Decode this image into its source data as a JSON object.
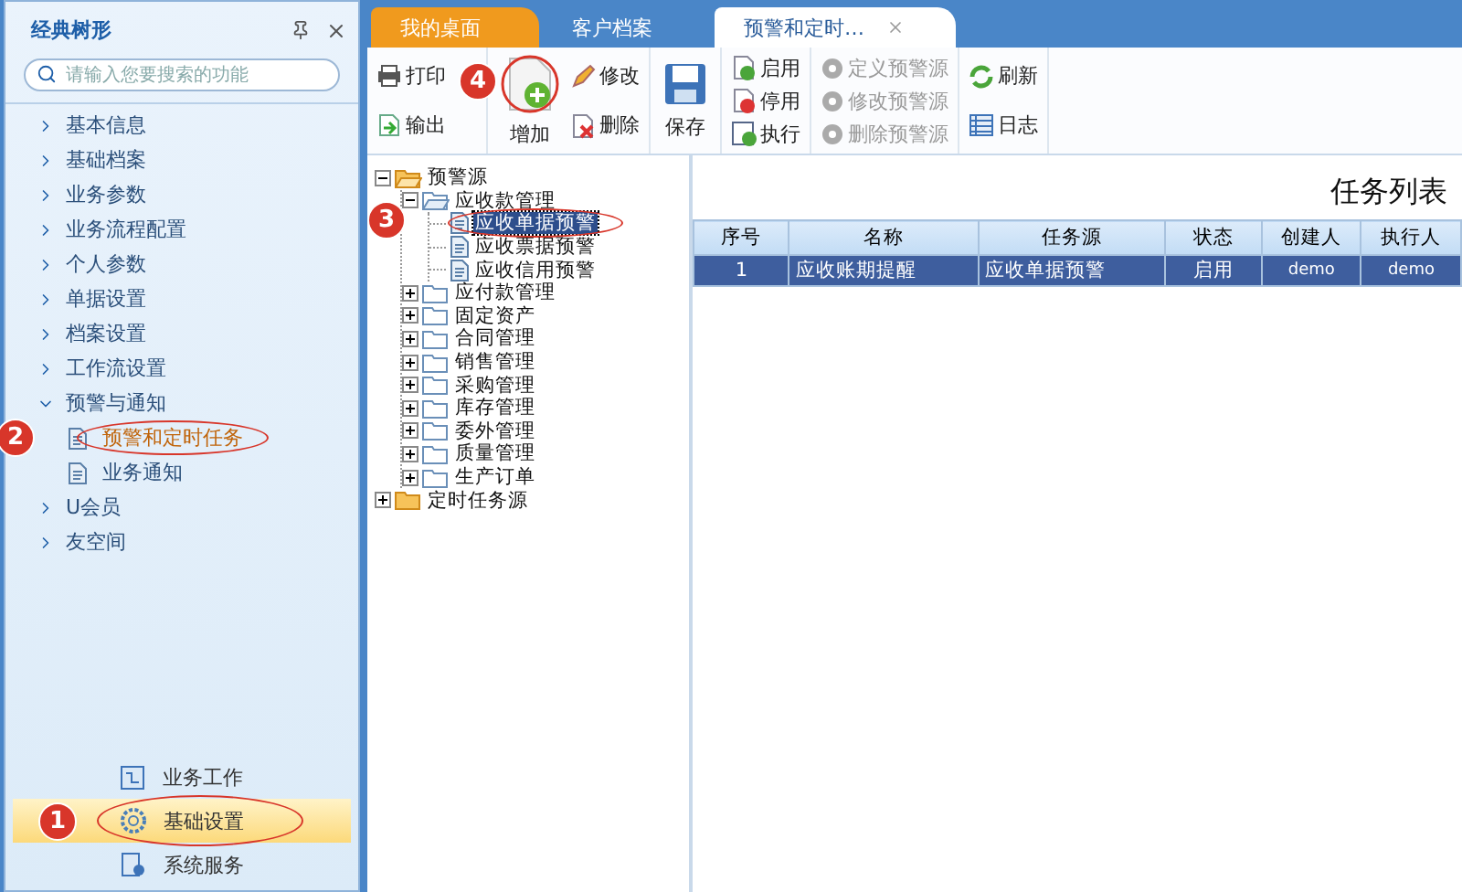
{
  "sidebar": {
    "title": "经典树形",
    "search": {
      "placeholder": "请输入您要搜索的功能"
    },
    "items": [
      {
        "label": "基本信息",
        "expanded": false
      },
      {
        "label": "基础档案",
        "expanded": false
      },
      {
        "label": "业务参数",
        "expanded": false
      },
      {
        "label": "业务流程配置",
        "expanded": false
      },
      {
        "label": "个人参数",
        "expanded": false
      },
      {
        "label": "单据设置",
        "expanded": false
      },
      {
        "label": "档案设置",
        "expanded": false
      },
      {
        "label": "工作流设置",
        "expanded": false
      },
      {
        "label": "预警与通知",
        "expanded": true,
        "children": [
          {
            "label": "预警和定时任务",
            "selected": true,
            "callout": "2"
          },
          {
            "label": "业务通知",
            "selected": false
          }
        ]
      },
      {
        "label": "U会员",
        "expanded": false
      },
      {
        "label": "友空间",
        "expanded": false
      }
    ],
    "bottom": [
      {
        "label": "业务工作",
        "kind": "work",
        "selected": false
      },
      {
        "label": "基础设置",
        "kind": "settings",
        "selected": true,
        "callout": "1"
      },
      {
        "label": "系统服务",
        "kind": "service",
        "selected": false
      }
    ]
  },
  "tabs": [
    {
      "label": "我的桌面",
      "selected": false,
      "kind": "home"
    },
    {
      "label": "客户档案",
      "selected": false,
      "kind": "plain"
    },
    {
      "label": "预警和定时…",
      "selected": true,
      "kind": "plain",
      "closable": true
    }
  ],
  "toolbar": [
    [
      {
        "label": "打印",
        "kind": "print",
        "disabled": false
      },
      {
        "label": "输出",
        "kind": "export",
        "disabled": false
      }
    ],
    [
      {
        "label": "增加",
        "kind": "add",
        "big": true,
        "disabled": false,
        "callout": "4"
      },
      {
        "label": "修改",
        "kind": "edit",
        "disabled": false
      },
      {
        "label": "删除",
        "kind": "delete",
        "disabled": false
      }
    ],
    [
      {
        "label": "保存",
        "kind": "save",
        "big": true,
        "disabled": false
      }
    ],
    [
      {
        "label": "启用",
        "kind": "enable",
        "disabled": false
      },
      {
        "label": "停用",
        "kind": "disable",
        "disabled": false
      },
      {
        "label": "执行",
        "kind": "run",
        "disabled": false
      }
    ],
    [
      {
        "label": "定义预警源",
        "kind": "source",
        "disabled": true
      },
      {
        "label": "修改预警源",
        "kind": "source",
        "disabled": true
      },
      {
        "label": "删除预警源",
        "kind": "source",
        "disabled": true
      }
    ],
    [
      {
        "label": "刷新",
        "kind": "refresh",
        "disabled": false
      },
      {
        "label": "日志",
        "kind": "log",
        "disabled": false
      }
    ]
  ],
  "tree": [
    {
      "label": "预警源",
      "expanded": true,
      "selected": false,
      "kind": "root",
      "children": [
        {
          "label": "应收款管理",
          "expanded": true,
          "selected": false,
          "kind": "folder",
          "children": [
            {
              "label": "应收单据预警",
              "selected": true,
              "kind": "leaf",
              "callout": "3"
            },
            {
              "label": "应收票据预警",
              "selected": false,
              "kind": "leaf"
            },
            {
              "label": "应收信用预警",
              "selected": false,
              "kind": "leaf"
            }
          ]
        },
        {
          "label": "应付款管理",
          "expanded": false,
          "selected": false,
          "kind": "folder"
        },
        {
          "label": "固定资产",
          "expanded": false,
          "selected": false,
          "kind": "folder"
        },
        {
          "label": "合同管理",
          "expanded": false,
          "selected": false,
          "kind": "folder"
        },
        {
          "label": "销售管理",
          "expanded": false,
          "selected": false,
          "kind": "folder"
        },
        {
          "label": "采购管理",
          "expanded": false,
          "selected": false,
          "kind": "folder"
        },
        {
          "label": "库存管理",
          "expanded": false,
          "selected": false,
          "kind": "folder"
        },
        {
          "label": "委外管理",
          "expanded": false,
          "selected": false,
          "kind": "folder"
        },
        {
          "label": "质量管理",
          "expanded": false,
          "selected": false,
          "kind": "folder"
        },
        {
          "label": "生产订单",
          "expanded": false,
          "selected": false,
          "kind": "folder"
        }
      ]
    },
    {
      "label": "定时任务源",
      "expanded": false,
      "selected": false,
      "kind": "root"
    }
  ],
  "task_list": {
    "title": "任务列表",
    "columns": [
      "序号",
      "名称",
      "任务源",
      "状态",
      "创建人",
      "执行人"
    ],
    "rows": [
      {
        "cells": [
          "1",
          "应收账期提醒",
          "应收单据预警",
          "启用",
          "demo",
          "demo"
        ],
        "selected": true
      }
    ]
  }
}
